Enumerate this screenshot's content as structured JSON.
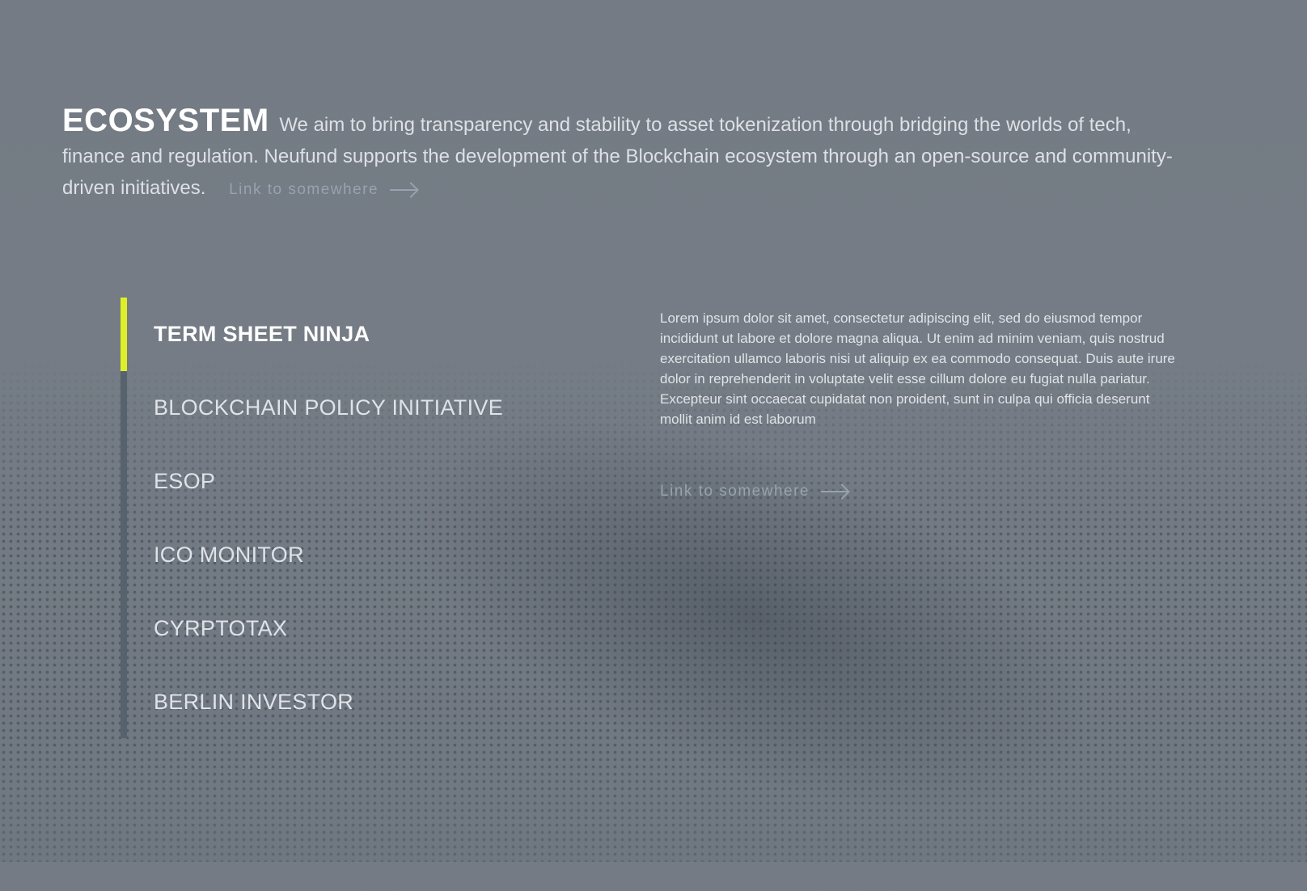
{
  "intro": {
    "title": "ECOSYSTEM",
    "text": "We aim to bring transparency and stability to asset tokenization through bridging the worlds of tech, finance and regulation. Neufund supports the development of the Blockchain ecosystem through an open-source and community-driven initiatives.",
    "link_label": "Link to somewhere"
  },
  "menu": {
    "items": [
      {
        "label": "TERM SHEET NINJA",
        "active": true
      },
      {
        "label": "BLOCKCHAIN POLICY INITIATIVE"
      },
      {
        "label": "ESOP"
      },
      {
        "label": "ICO MONITOR"
      },
      {
        "label": "CYRPTOTAX"
      },
      {
        "label": "BERLIN INVESTOR"
      }
    ]
  },
  "detail": {
    "description": "Lorem ipsum dolor sit amet, consectetur adipiscing elit, sed do eiusmod tempor incididunt ut labore et dolore magna aliqua. Ut enim ad minim veniam, quis nostrud exercitation ullamco laboris nisi ut aliquip ex ea commodo consequat. Duis aute irure dolor in reprehenderit in voluptate velit esse cillum dolore eu fugiat nulla pariatur. Excepteur sint occaecat cupidatat non proident, sunt in culpa qui officia deserunt mollit anim id est laborum",
    "link_label": "Link to somewhere"
  },
  "colors": {
    "accent": "#dff126",
    "rail": "#56636f",
    "background": "#747b84"
  }
}
